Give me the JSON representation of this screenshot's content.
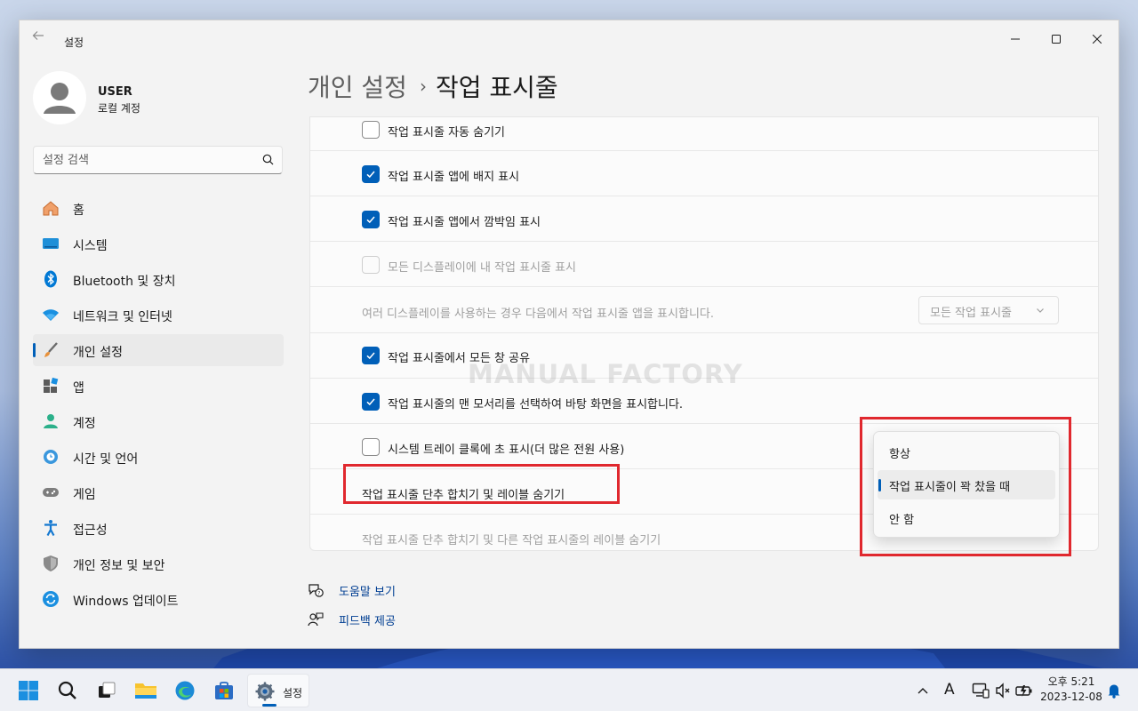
{
  "window": {
    "title": "설정",
    "back_icon": "arrow-left-icon"
  },
  "user": {
    "name": "USER",
    "account_type": "로컬 계정"
  },
  "search": {
    "placeholder": "설정 검색"
  },
  "sidebar": {
    "items": [
      {
        "label": "홈",
        "icon": "home-icon",
        "active": false
      },
      {
        "label": "시스템",
        "icon": "system-icon",
        "active": false
      },
      {
        "label": "Bluetooth 및 장치",
        "icon": "bluetooth-icon",
        "active": false
      },
      {
        "label": "네트워크 및 인터넷",
        "icon": "wifi-icon",
        "active": false
      },
      {
        "label": "개인 설정",
        "icon": "brush-icon",
        "active": true
      },
      {
        "label": "앱",
        "icon": "apps-icon",
        "active": false
      },
      {
        "label": "계정",
        "icon": "account-icon",
        "active": false
      },
      {
        "label": "시간 및 언어",
        "icon": "time-language-icon",
        "active": false
      },
      {
        "label": "게임",
        "icon": "gamepad-icon",
        "active": false
      },
      {
        "label": "접근성",
        "icon": "accessibility-icon",
        "active": false
      },
      {
        "label": "개인 정보 및 보안",
        "icon": "shield-icon",
        "active": false
      },
      {
        "label": "Windows 업데이트",
        "icon": "update-icon",
        "active": false
      }
    ]
  },
  "header": {
    "breadcrumb": "개인 설정",
    "separator": "›",
    "title": "작업 표시줄"
  },
  "settings": {
    "rows": [
      {
        "label": "작업 표시줄 자동 숨기기",
        "checked": false,
        "disabled": false
      },
      {
        "label": "작업 표시줄 앱에 배지 표시",
        "checked": true,
        "disabled": false
      },
      {
        "label": "작업 표시줄 앱에서 깜박임 표시",
        "checked": true,
        "disabled": false
      },
      {
        "label": "모든 디스플레이에 내 작업 표시줄 표시",
        "checked": false,
        "disabled": true
      },
      {
        "label": "여러 디스플레이를 사용하는 경우 다음에서 작업 표시줄 앱을 표시합니다.",
        "select_value": "모든 작업 표시줄",
        "disabled": true
      },
      {
        "label": "작업 표시줄에서 모든 창 공유",
        "checked": true,
        "disabled": false
      },
      {
        "label": "작업 표시줄의 맨 모서리를 선택하여 바탕 화면을 표시합니다.",
        "checked": true,
        "disabled": false
      },
      {
        "label": "시스템 트레이 클록에 초 표시(더 많은 전원 사용)",
        "checked": false,
        "disabled": false
      },
      {
        "label": "작업 표시줄 단추 합치기 및 레이블 숨기기",
        "disabled": false
      },
      {
        "label": "작업 표시줄 단추 합치기 및 다른 작업 표시줄의 레이블 숨기기",
        "disabled": true
      }
    ],
    "watermark": "MANUAL FACTORY"
  },
  "dropdown": {
    "options": [
      "항상",
      "작업 표시줄이 꽉 찼을 때",
      "안 함"
    ],
    "selected": "작업 표시줄이 꽉 찼을 때"
  },
  "help": {
    "get_help": "도움말 보기",
    "give_feedback": "피드백 제공"
  },
  "taskbar": {
    "active_app_label": "설정",
    "time": "오후 5:21",
    "date": "2023-12-08",
    "ime": "A"
  },
  "colors": {
    "accent": "#005fb8",
    "highlight": "#e0282e"
  }
}
